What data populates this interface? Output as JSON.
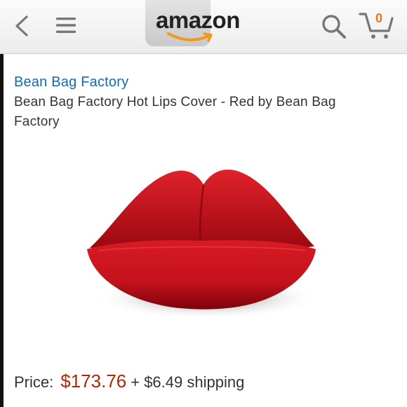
{
  "header": {
    "logo_text": "amazon",
    "cart_count": "0",
    "icons": [
      "back-icon",
      "menu-icon",
      "search-icon",
      "cart-icon"
    ]
  },
  "product": {
    "brand": "Bean Bag Factory",
    "title": "Bean Bag Factory Hot Lips Cover - Red by Bean Bag Factory",
    "image_subject": "red-lips-sofa"
  },
  "pricing": {
    "price_label": "Price:",
    "price": "$173.76",
    "shipping": "+ $6.49 shipping"
  },
  "colors": {
    "brand_link": "#136ab0",
    "price": "#b12704",
    "logo_smile": "#f09a1c",
    "product_red": "#c4121c"
  }
}
